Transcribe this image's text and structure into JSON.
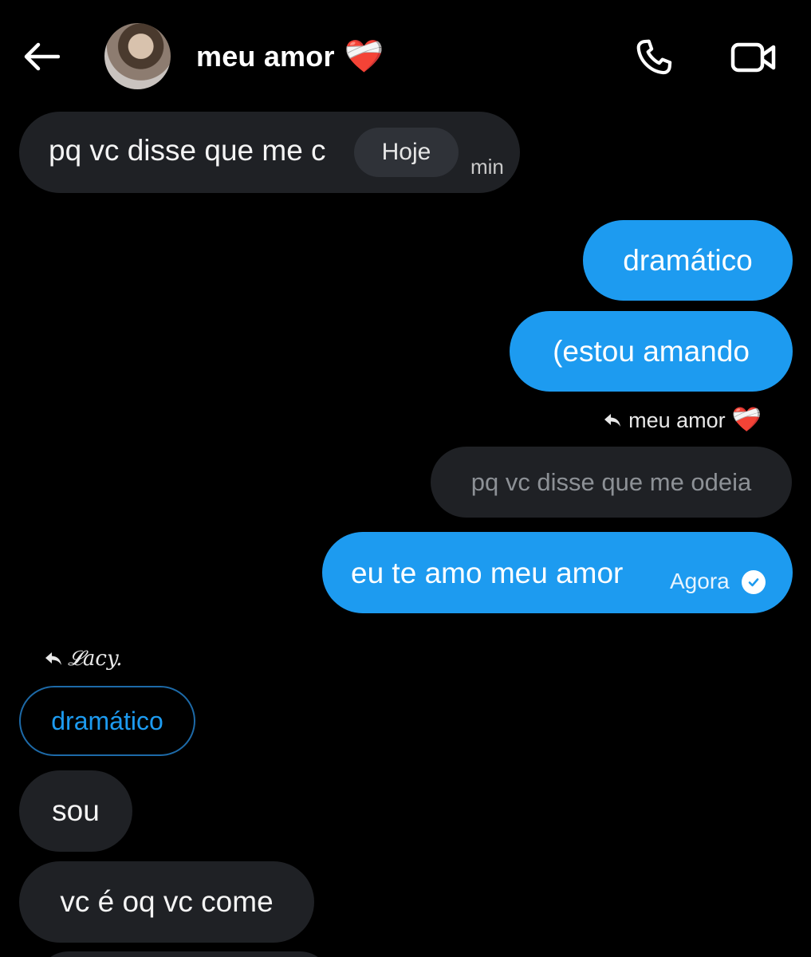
{
  "header": {
    "title": "meu amor",
    "title_emoji": "❤️‍🩹",
    "back_icon": "arrow-left-icon",
    "call_icon": "phone-icon",
    "video_icon": "video-camera-icon"
  },
  "date_separator": "Hoje",
  "messages": [
    {
      "side": "in",
      "text": "pq vc disse que me c",
      "time_fragment": "min"
    },
    {
      "side": "out",
      "text": "dramático"
    },
    {
      "side": "out",
      "text": "(estou amando"
    },
    {
      "side": "out",
      "reply_to_name": "meu amor",
      "reply_to_emoji": "❤️‍🩹",
      "quoted_text": "pq vc disse que me odeia",
      "text": "eu te amo meu amor",
      "time": "Agora",
      "status_icon": "read-check-icon"
    },
    {
      "side": "in",
      "reply_to_name": "𝓛acy.",
      "quoted_text": "dramático",
      "text": "sou"
    },
    {
      "side": "in",
      "text": "vc é oq vc come"
    }
  ],
  "colors": {
    "background": "#000000",
    "incoming_bubble": "#1f2125",
    "outgoing_bubble": "#1d9bf0",
    "accent": "#1d9bf0"
  }
}
